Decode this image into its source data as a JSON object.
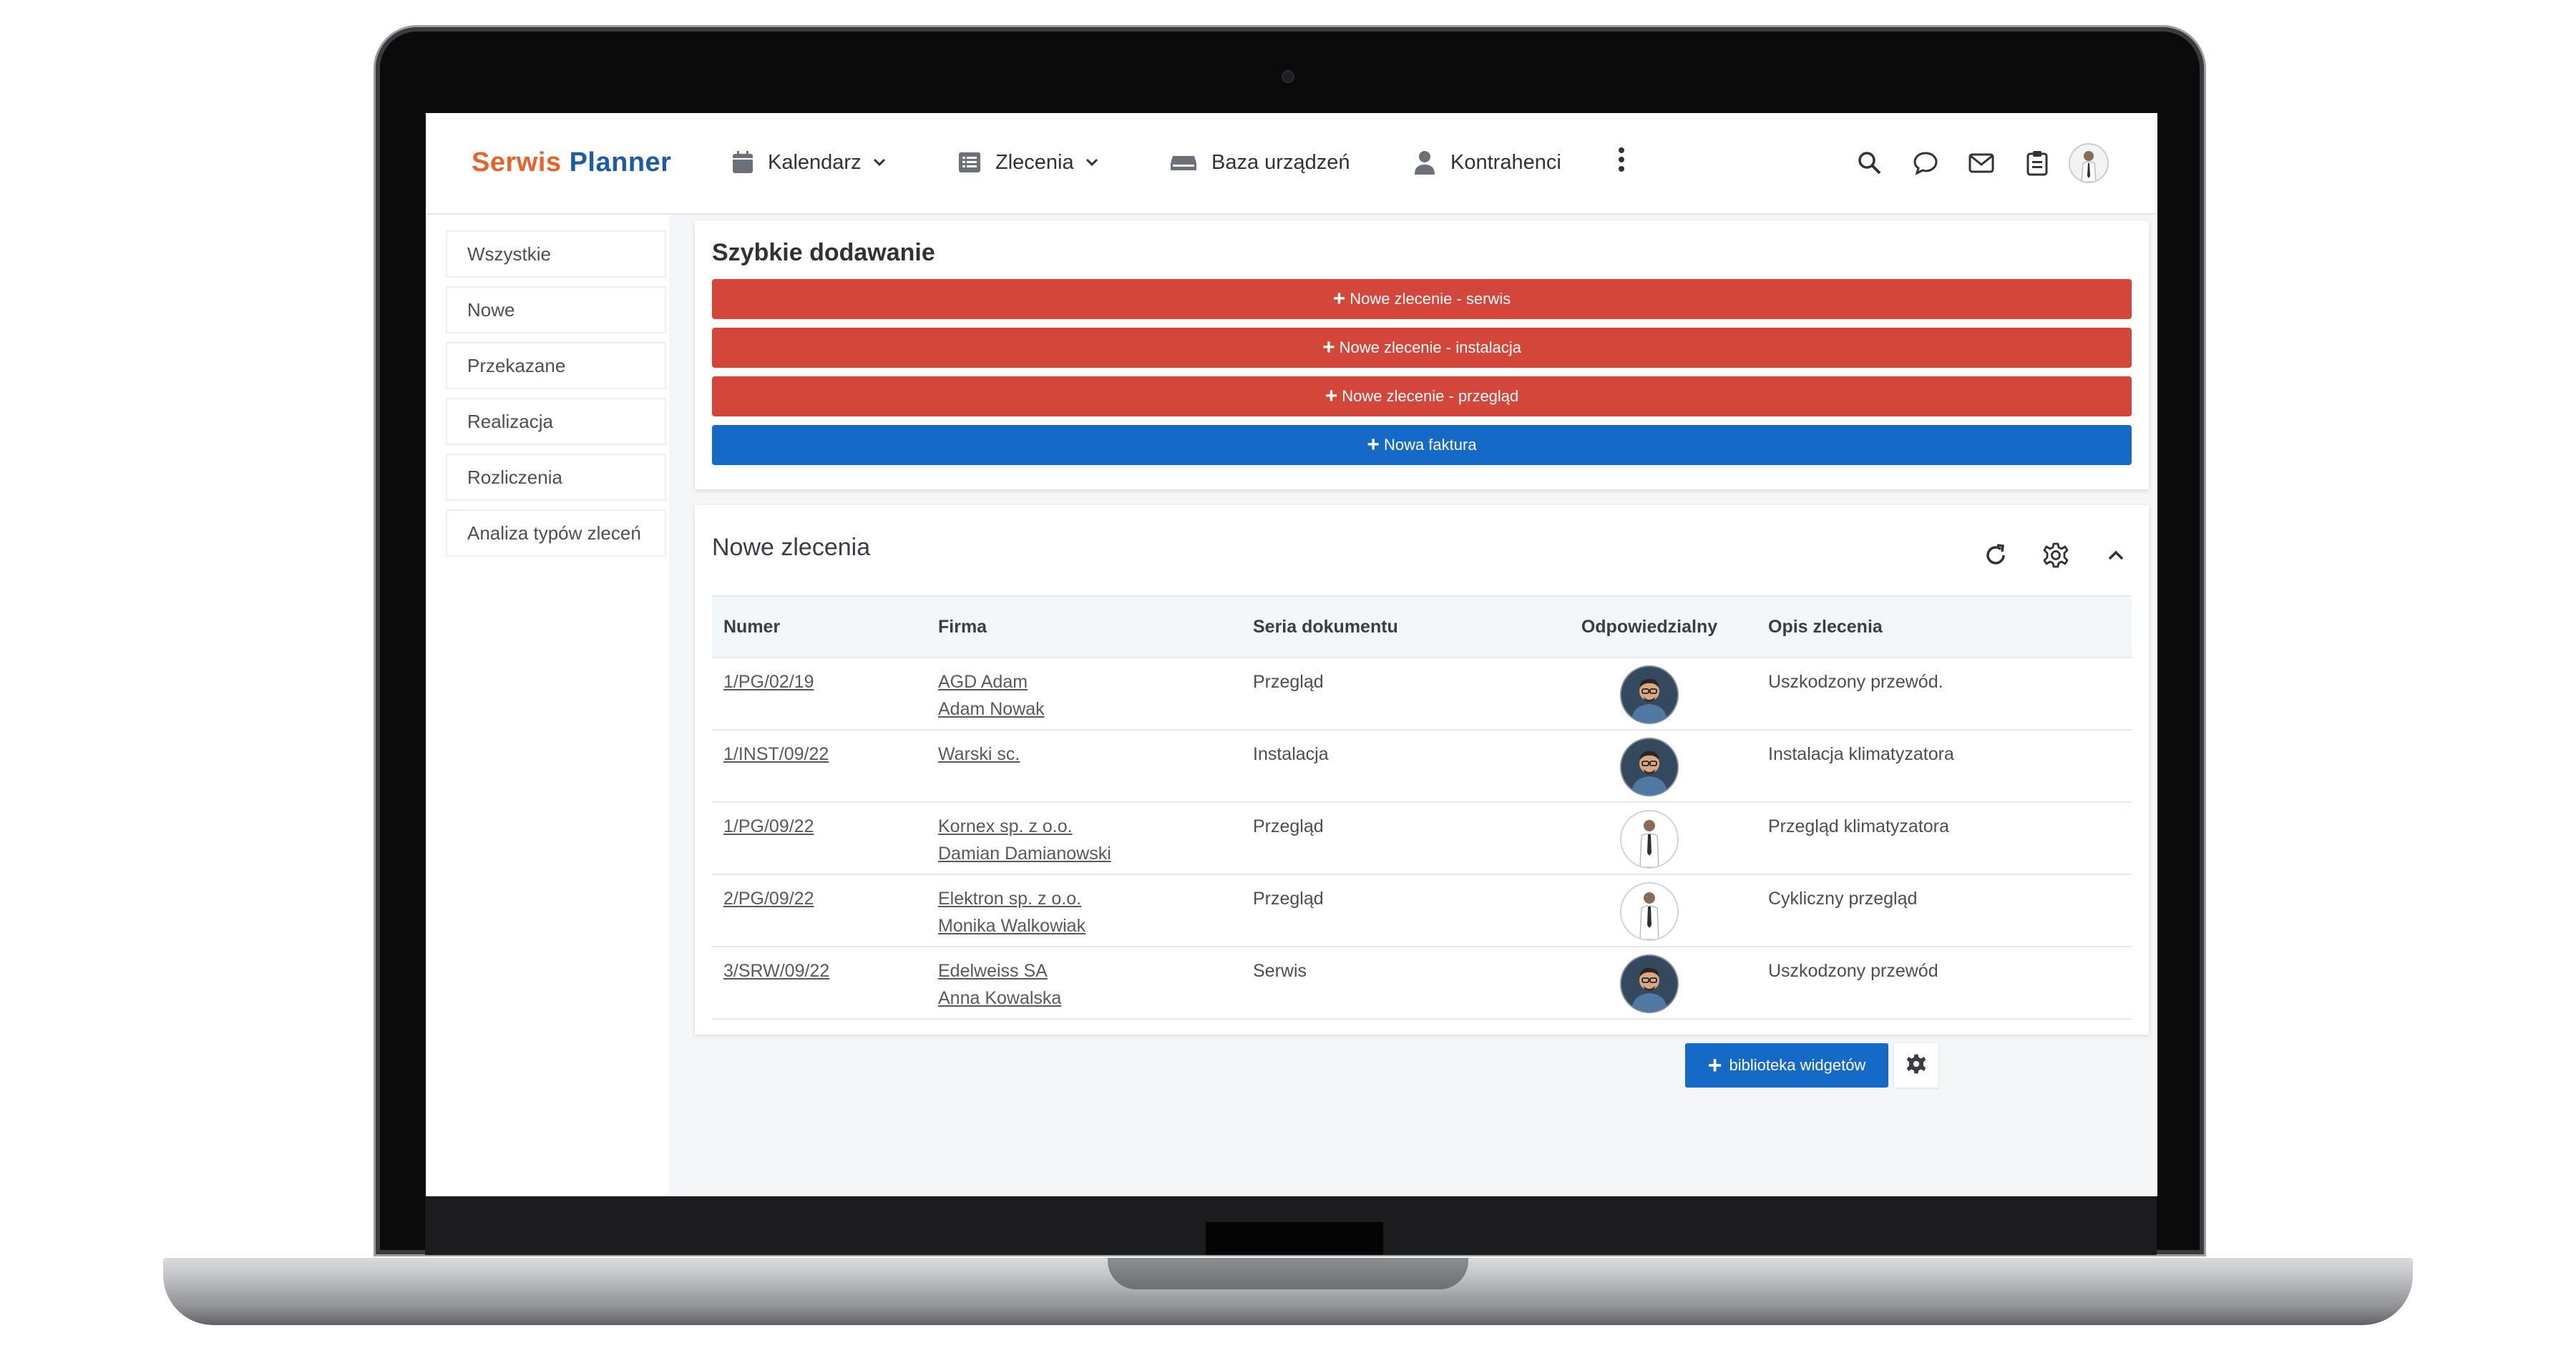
{
  "brand": {
    "part1": "Serwis",
    "part2": " Planner"
  },
  "nav": {
    "calendar": "Kalendarz",
    "orders": "Zlecenia",
    "devices": "Baza urządzeń",
    "contractors": "Kontrahenci"
  },
  "sidebar": {
    "items": [
      {
        "label": "Wszystkie"
      },
      {
        "label": "Nowe"
      },
      {
        "label": "Przekazane"
      },
      {
        "label": "Realizacja"
      },
      {
        "label": "Rozliczenia"
      },
      {
        "label": "Analiza typów zleceń"
      }
    ]
  },
  "quick_add": {
    "title": "Szybkie dodawanie",
    "buttons": [
      {
        "label": "Nowe zlecenie - serwis"
      },
      {
        "label": "Nowe zlecenie - instalacja"
      },
      {
        "label": "Nowe zlecenie - przegląd"
      },
      {
        "label": "Nowa faktura"
      }
    ]
  },
  "new_orders": {
    "title": "Nowe zlecenia",
    "columns": [
      "Numer",
      "Firma",
      "Seria dokumentu",
      "Odpowiedzialny",
      "Opis zlecenia"
    ],
    "rows": [
      {
        "number": "1/PG/02/19",
        "company": "AGD Adam",
        "contact": "Adam Nowak",
        "series": "Przegląd",
        "description": "Uszkodzony przewód."
      },
      {
        "number": "1/INST/09/22",
        "company": "Warski sc.",
        "contact": "",
        "series": "Instalacja",
        "description": "Instalacja klimatyzatora"
      },
      {
        "number": "1/PG/09/22",
        "company": "Kornex sp. z o.o.",
        "contact": "Damian Damianowski",
        "series": "Przegląd",
        "description": "Przegląd klimatyzatora"
      },
      {
        "number": "2/PG/09/22",
        "company": "Elektron sp. z o.o.",
        "contact": "Monika Walkowiak",
        "series": "Przegląd",
        "description": "Cykliczny przegląd"
      },
      {
        "number": "3/SRW/09/22",
        "company": "Edelweiss SA",
        "contact": "Anna Kowalska",
        "series": "Serwis",
        "description": "Uszkodzony przewód"
      }
    ]
  },
  "footer": {
    "library_button": "biblioteka widgetów"
  },
  "colors": {
    "accent_red": "#d5463a",
    "accent_blue": "#1569c7",
    "brand_orange": "#e8632b",
    "brand_blue": "#1d5aa8"
  },
  "icons": [
    "calendar-icon",
    "list-icon",
    "device-icon",
    "person-icon",
    "kebab-menu-icon",
    "search-icon",
    "chat-icon",
    "mail-icon",
    "clipboard-icon",
    "refresh-icon",
    "gear-icon",
    "chevron-up-icon",
    "plus-icon"
  ]
}
